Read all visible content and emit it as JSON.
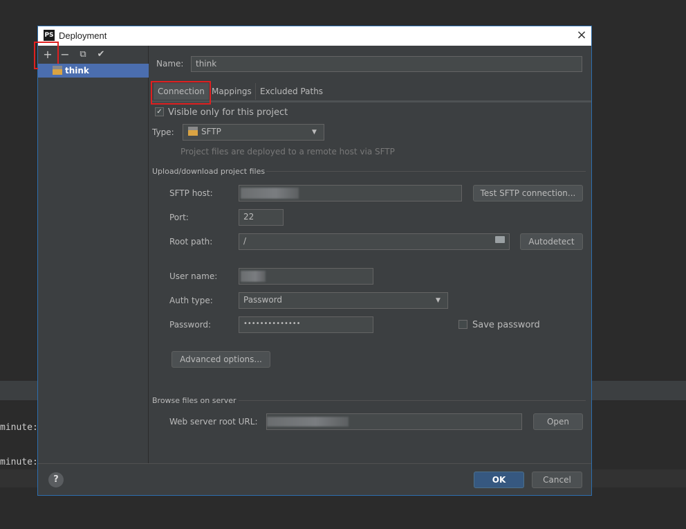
{
  "background": {
    "line1": "minute:",
    "line2": "minute:"
  },
  "dialog": {
    "logo": "PS",
    "title": "Deployment",
    "close_icon": "×"
  },
  "toolbar": {
    "add_icon": "+",
    "remove_icon": "−",
    "copy_icon": "⧉",
    "check_icon": "✔"
  },
  "tree": {
    "item_label": "think",
    "item_icon_label": "SFTP"
  },
  "form": {
    "name_label": "Name:",
    "name_value": "think",
    "tabs": [
      {
        "label": "Connection"
      },
      {
        "label": "Mappings"
      },
      {
        "label": "Excluded Paths"
      }
    ],
    "visible_only_label": "Visible only for this project",
    "visible_only_checked": "✓",
    "type_label": "Type:",
    "type_value": "SFTP",
    "type_hint": "Project files are deployed to a remote host via SFTP",
    "upload_section": "Upload/download project files",
    "sftp_host_label": "SFTP host:",
    "test_button": "Test SFTP connection...",
    "port_label": "Port:",
    "port_value": "22",
    "root_path_label": "Root path:",
    "root_path_value": "/",
    "autodetect_button": "Autodetect",
    "user_name_label": "User name:",
    "auth_type_label": "Auth type:",
    "auth_type_value": "Password",
    "password_label": "Password:",
    "password_value": "••••••••••••••",
    "save_password_label": "Save password",
    "advanced_button": "Advanced options...",
    "browse_section": "Browse files on server",
    "web_root_label": "Web server root URL:",
    "open_button": "Open"
  },
  "footer": {
    "help_icon": "?",
    "ok_button": "OK",
    "cancel_button": "Cancel"
  },
  "colors": {
    "accent": "#4b6eaf",
    "primary_button": "#365880",
    "highlight_box": "#e02020"
  }
}
